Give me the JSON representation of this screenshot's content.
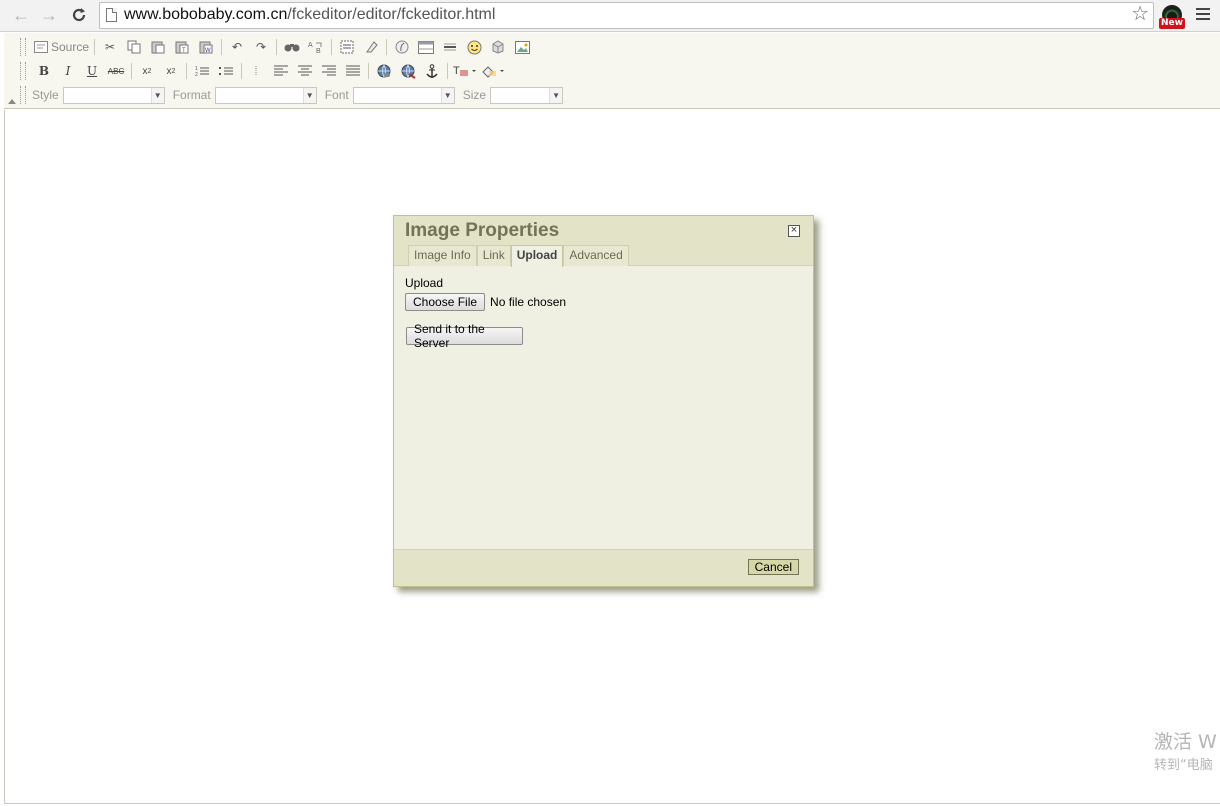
{
  "browser": {
    "url_host": "www.bobobaby.com.cn",
    "url_path": "/fckeditor/editor/fckeditor.html",
    "ext_badge": "New"
  },
  "toolbar": {
    "source_label": "Source",
    "bold_label": "B",
    "italic_label": "I",
    "underline_label": "U",
    "strike_label": "ABC",
    "style_label": "Style",
    "format_label": "Format",
    "font_label": "Font",
    "size_label": "Size"
  },
  "dialog": {
    "title": "Image Properties",
    "tabs": [
      {
        "label": "Image Info",
        "selected": false
      },
      {
        "label": "Link",
        "selected": false
      },
      {
        "label": "Upload",
        "selected": true
      },
      {
        "label": "Advanced",
        "selected": false
      }
    ],
    "upload_label": "Upload",
    "choose_file_label": "Choose File",
    "no_file_text": "No file chosen",
    "send_label": "Send it to the Server",
    "cancel_label": "Cancel"
  },
  "watermark": {
    "line1": "激活 W",
    "line2": "转到“电脑"
  },
  "colors": {
    "dialog_bg": "#efefe2",
    "dialog_header": "#e3e3c7",
    "dialog_title": "#737357",
    "cancel_bg": "#d6d6a6"
  }
}
